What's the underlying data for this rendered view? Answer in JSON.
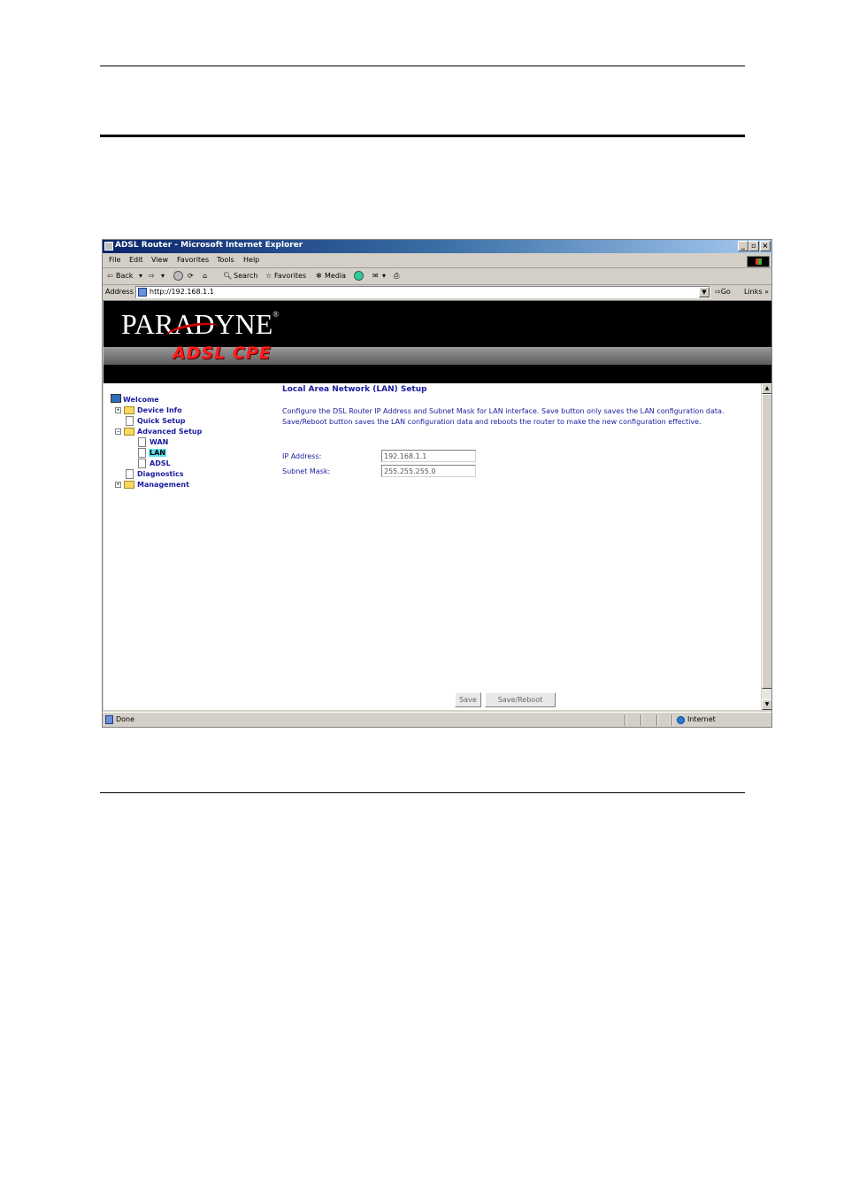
{
  "window": {
    "title": "ADSL Router - Microsoft Internet Explorer",
    "controls": {
      "minimize": "_",
      "maximize": "▫",
      "close": "×"
    }
  },
  "menu": [
    "File",
    "Edit",
    "View",
    "Favorites",
    "Tools",
    "Help"
  ],
  "toolbar": {
    "back": "Back",
    "search": "Search",
    "favorites": "Favorites",
    "media": "Media"
  },
  "address": {
    "label": "Address",
    "url": "http://192.168.1.1",
    "go": "Go",
    "links": "Links »"
  },
  "banner": {
    "logo": "PARADYNE",
    "registered": "®",
    "subtitle": "ADSL CPE"
  },
  "tree": {
    "root": "Welcome",
    "items": [
      {
        "label": "Device Info",
        "expander": "+"
      },
      {
        "label": "Quick Setup",
        "expander": ""
      },
      {
        "label": "Advanced Setup",
        "expander": "−"
      },
      {
        "label": "WAN",
        "expander": ""
      },
      {
        "label": "LAN",
        "expander": ""
      },
      {
        "label": "ADSL",
        "expander": ""
      },
      {
        "label": "Diagnostics",
        "expander": ""
      },
      {
        "label": "Management",
        "expander": "+"
      }
    ]
  },
  "page": {
    "title": "Local Area Network (LAN) Setup",
    "description": "Configure the DSL Router IP Address and Subnet Mask for LAN interface.  Save button only saves the LAN configuration data.  Save/Reboot button saves the LAN configuration data and reboots the router to make the new configuration effective.",
    "ip_label": "IP Address:",
    "ip_value": "192.168.1.1",
    "mask_label": "Subnet Mask:",
    "mask_value": "255.255.255.0",
    "save": "Save",
    "save_reboot": "Save/Reboot"
  },
  "status": {
    "text": "Done",
    "zone": "Internet"
  }
}
